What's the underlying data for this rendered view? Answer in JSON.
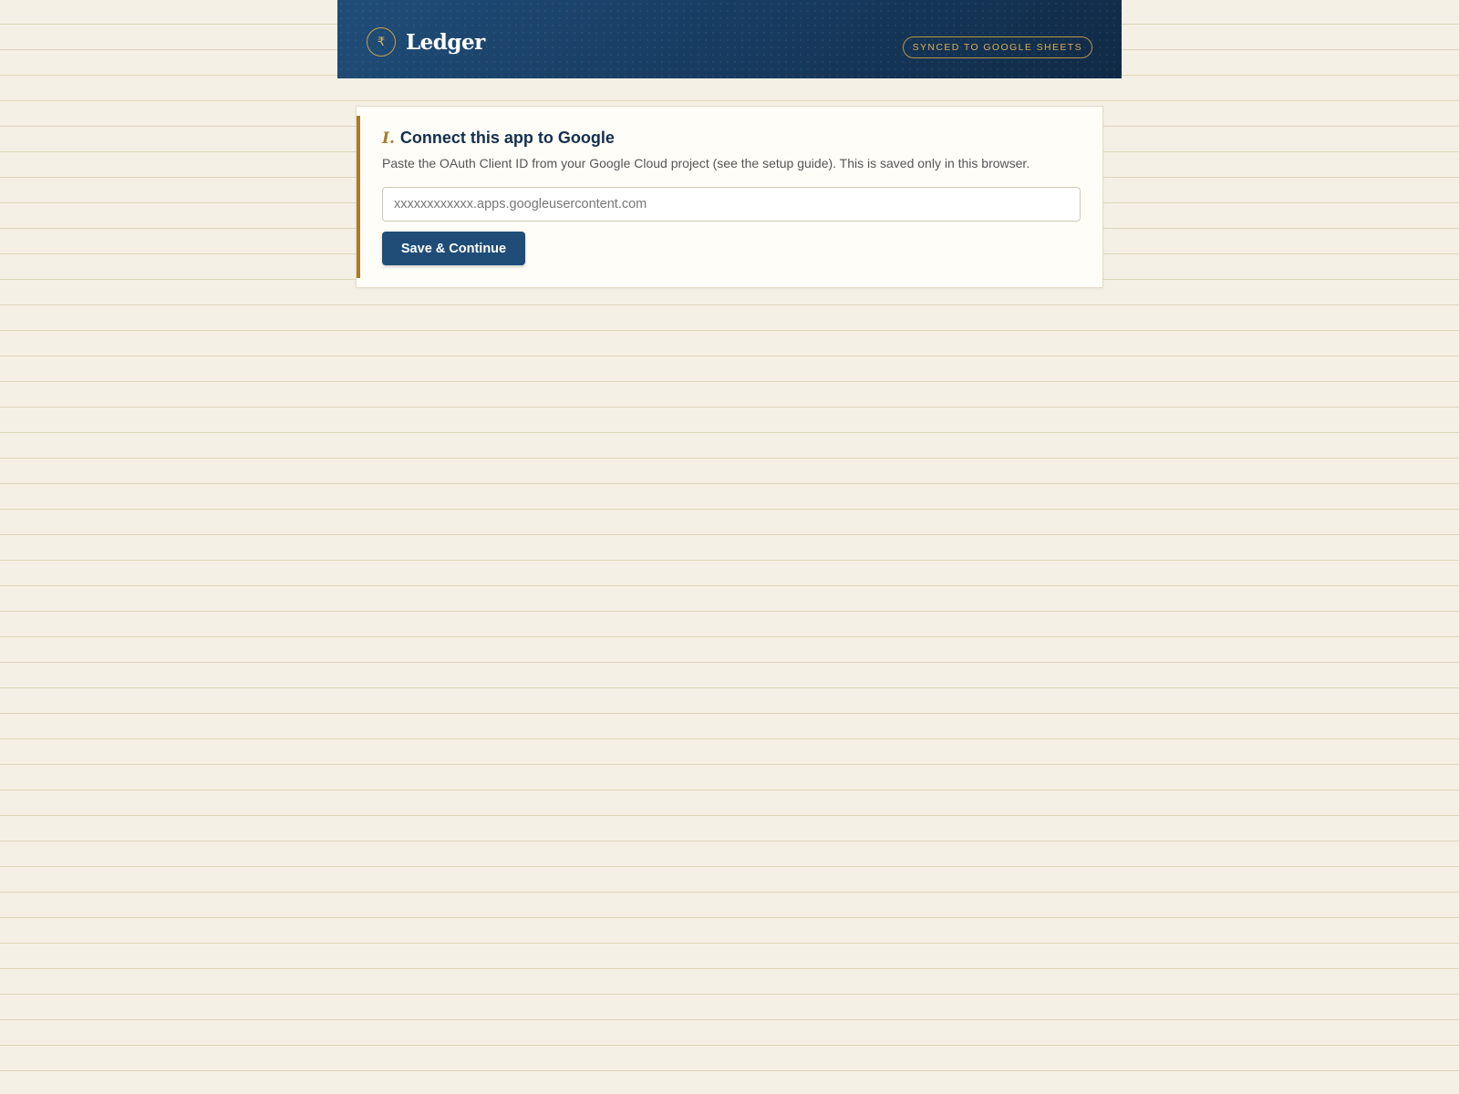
{
  "header": {
    "app_name": "Ledger",
    "logo_icon": "rupee-icon",
    "logo_glyph": "₹",
    "sync_badge": "SYNCED TO GOOGLE SHEETS"
  },
  "setup_card": {
    "step_numeral": "I.",
    "title": "Connect this app to Google",
    "description": "Paste the OAuth Client ID from your Google Cloud project (see the setup guide). This is saved only in this browser.",
    "client_id_input": {
      "value": "",
      "placeholder": "xxxxxxxxxxxx.apps.googleusercontent.com"
    },
    "save_button_label": "Save & Continue"
  },
  "colors": {
    "page_background": "#f5f0e6",
    "header_navy": "#1f4d78",
    "accent_gold": "#a57c2c",
    "button_navy": "#1f4d78"
  }
}
